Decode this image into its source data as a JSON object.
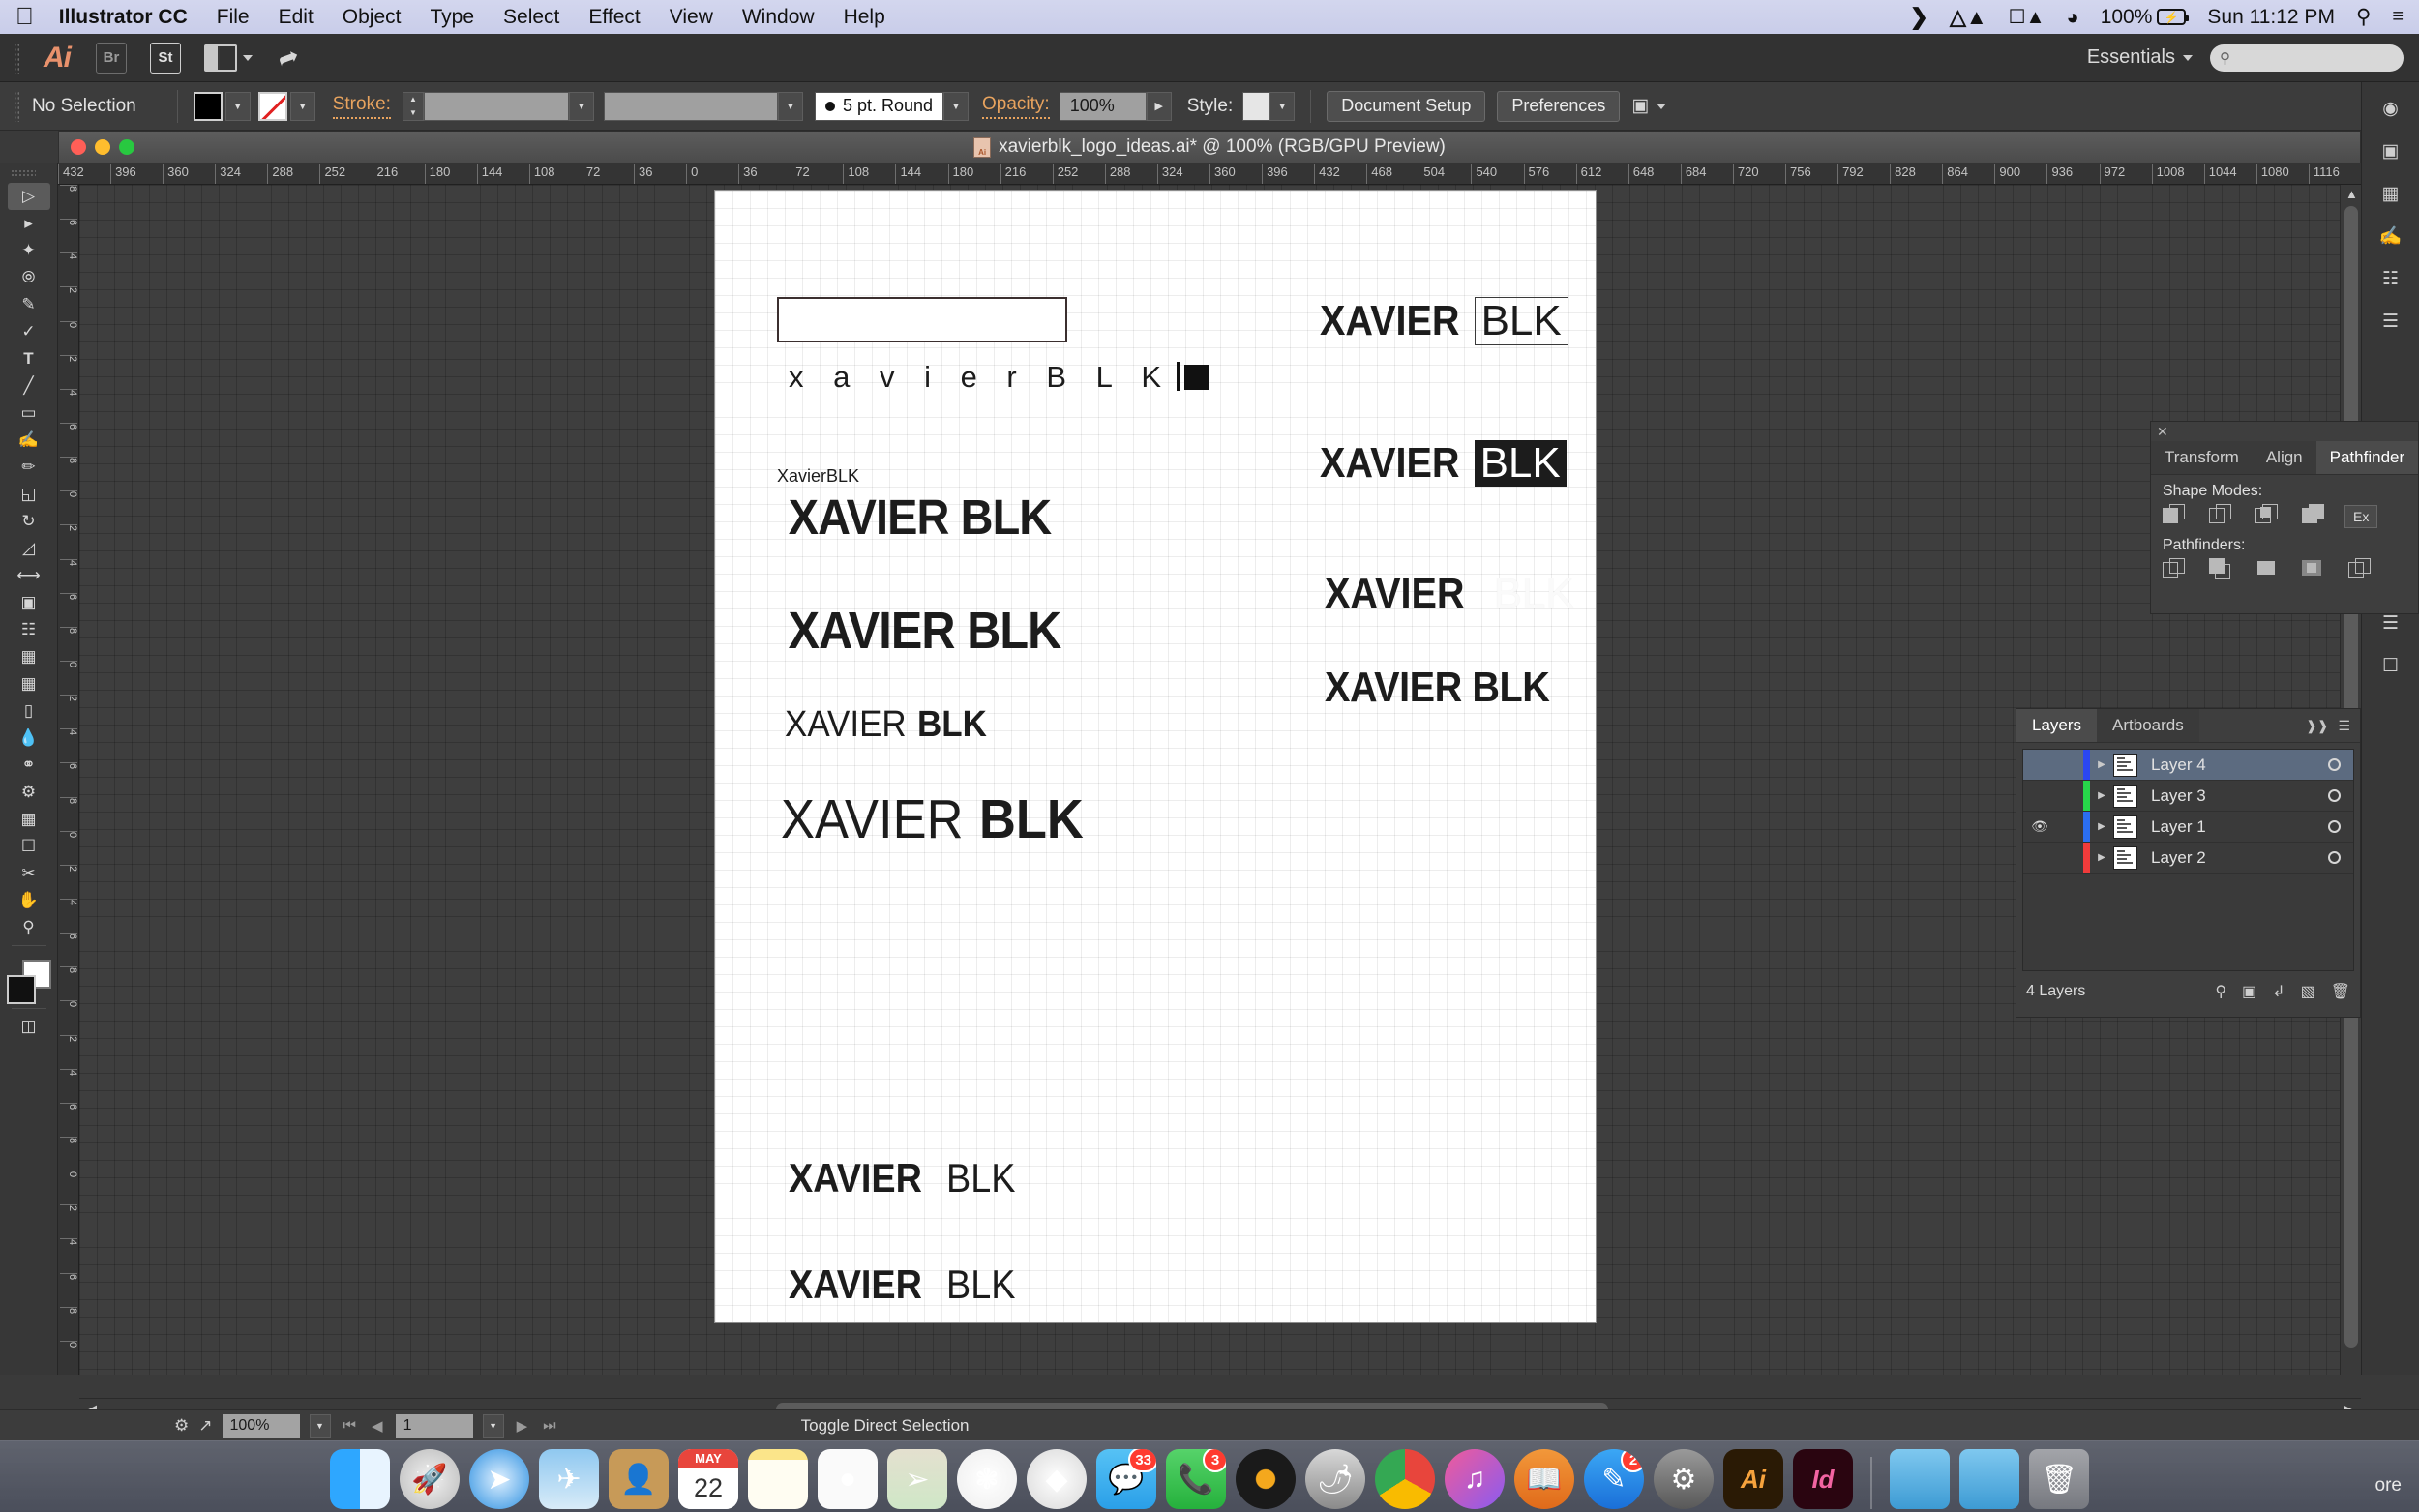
{
  "menubar": {
    "apple": "apple-logo",
    "app_name": "Illustrator CC",
    "items": [
      "File",
      "Edit",
      "Object",
      "Type",
      "Select",
      "Effect",
      "View",
      "Window",
      "Help"
    ],
    "battery_percent": "100%",
    "clock": "Sun 11:12 PM"
  },
  "appbar": {
    "ai_logo": "Ai",
    "bridge_label": "Br",
    "stock_label": "St",
    "workspace": "Essentials",
    "search_placeholder": ""
  },
  "controlbar": {
    "selection_status": "No Selection",
    "stroke_label": "Stroke:",
    "stroke_weight": "",
    "stroke_profile": "",
    "cap_style": "5 pt. Round",
    "opacity_label": "Opacity:",
    "opacity_value": "100%",
    "style_label": "Style:",
    "document_setup": "Document Setup",
    "preferences": "Preferences"
  },
  "document": {
    "title": "xavierblk_logo_ideas.ai* @ 100% (RGB/GPU Preview)"
  },
  "rulers": {
    "horizontal": [
      "432",
      "396",
      "360",
      "324",
      "288",
      "252",
      "216",
      "180",
      "144",
      "108",
      "72",
      "36",
      "0",
      "36",
      "72",
      "108",
      "144",
      "180",
      "216",
      "252",
      "288",
      "324",
      "360",
      "396",
      "432",
      "468",
      "504",
      "540",
      "576",
      "612",
      "648",
      "684",
      "720",
      "756",
      "792",
      "828",
      "864",
      "900",
      "936",
      "972",
      "1008",
      "1044",
      "1080",
      "1116"
    ],
    "vertical": [
      "8",
      "6",
      "4",
      "2",
      "0",
      "2",
      "4",
      "6",
      "8",
      "0",
      "2",
      "4",
      "6",
      "8",
      "0",
      "2",
      "4",
      "6",
      "8",
      "0",
      "2",
      "4",
      "6",
      "8",
      "0",
      "2",
      "4",
      "6",
      "8",
      "0",
      "2",
      "4",
      "6",
      "8",
      "0"
    ]
  },
  "artwork": {
    "variants": [
      {
        "name": "empty-rectangle",
        "text": ""
      },
      {
        "name": "spaced-lowercase-lockup",
        "text": "x a v i e r B L K"
      },
      {
        "name": "small-label",
        "text": "XavierBLK"
      },
      {
        "name": "bold-xavier-blk-1",
        "text": "XAVIER BLK"
      },
      {
        "name": "bold-xavier-blk-2",
        "text": "XAVIER BLK"
      },
      {
        "name": "light-xavier-bold-blk-small",
        "light": "XAVIER",
        "bold": "BLK"
      },
      {
        "name": "light-xavier-bold-blk-large",
        "light": "XAVIER",
        "bold": "BLK"
      },
      {
        "name": "bold-xavier-light-blk-1",
        "bold": "XAVIER",
        "light": "BLK"
      },
      {
        "name": "bold-xavier-light-blk-2",
        "bold": "XAVIER",
        "light": "BLK"
      },
      {
        "name": "xavier-boxed-blk",
        "bold": "XAVIER",
        "boxed": "BLK"
      },
      {
        "name": "xavier-inverted-blk",
        "bold": "XAVIER",
        "inverted": "BLK"
      },
      {
        "name": "xavier-white-blk",
        "bold": "XAVIER",
        "white": "BLK"
      },
      {
        "name": "xavier-blk-plain",
        "text": "XAVIER BLK"
      }
    ]
  },
  "pathfinder": {
    "tabs": [
      "Transform",
      "Align",
      "Pathfinder"
    ],
    "active_tab": "Pathfinder",
    "shape_modes_label": "Shape Modes:",
    "pathfinders_label": "Pathfinders:",
    "expand_label": "Ex"
  },
  "layers": {
    "tabs": [
      "Layers",
      "Artboards"
    ],
    "active_tab": "Layers",
    "rows": [
      {
        "name": "Layer 4",
        "color": "#2b47f0",
        "visible": false,
        "selected": true
      },
      {
        "name": "Layer 3",
        "color": "#27d74a",
        "visible": false,
        "selected": false
      },
      {
        "name": "Layer 1",
        "color": "#2b6ef0",
        "visible": true,
        "selected": false
      },
      {
        "name": "Layer 2",
        "color": "#f03b3b",
        "visible": false,
        "selected": false
      }
    ],
    "count_label": "4 Layers"
  },
  "statusbar": {
    "zoom": "100%",
    "page": "1",
    "status_text": "Toggle Direct Selection"
  },
  "dock": {
    "items": [
      {
        "name": "finder",
        "glyph": "",
        "badge": "",
        "running": true
      },
      {
        "name": "launchpad",
        "glyph": "",
        "badge": "",
        "running": false
      },
      {
        "name": "safari",
        "glyph": "",
        "badge": "",
        "running": false
      },
      {
        "name": "mail",
        "glyph": "",
        "badge": "",
        "running": false
      },
      {
        "name": "contacts",
        "glyph": "",
        "badge": "",
        "running": false
      },
      {
        "name": "calendar",
        "glyph": "",
        "badge": "",
        "running": false,
        "month": "MAY",
        "day": "22"
      },
      {
        "name": "notes",
        "glyph": "",
        "badge": "",
        "running": false
      },
      {
        "name": "reminders",
        "glyph": "",
        "badge": "",
        "running": true
      },
      {
        "name": "maps",
        "glyph": "",
        "badge": "",
        "running": false
      },
      {
        "name": "photos",
        "glyph": "",
        "badge": "",
        "running": false
      },
      {
        "name": "sims",
        "glyph": "",
        "badge": "",
        "running": false
      },
      {
        "name": "messages",
        "glyph": "",
        "badge": "33",
        "running": true
      },
      {
        "name": "facetime",
        "glyph": "",
        "badge": "3",
        "running": false
      },
      {
        "name": "djay",
        "glyph": "",
        "badge": "",
        "running": true
      },
      {
        "name": "fl-studio",
        "glyph": "",
        "badge": "",
        "running": false
      },
      {
        "name": "chrome",
        "glyph": "",
        "badge": "",
        "running": true
      },
      {
        "name": "itunes",
        "glyph": "",
        "badge": "",
        "running": true
      },
      {
        "name": "ibooks",
        "glyph": "",
        "badge": "",
        "running": false
      },
      {
        "name": "app-store",
        "glyph": "",
        "badge": "2",
        "running": false
      },
      {
        "name": "system-preferences",
        "glyph": "",
        "badge": "",
        "running": false
      },
      {
        "name": "illustrator",
        "glyph": "Ai",
        "badge": "",
        "running": true
      },
      {
        "name": "indesign",
        "glyph": "Id",
        "badge": "",
        "running": false
      },
      {
        "name": "documents-folder",
        "glyph": "",
        "badge": "",
        "running": false
      },
      {
        "name": "downloads-folder",
        "glyph": "",
        "badge": "",
        "running": false
      },
      {
        "name": "trash",
        "glyph": "",
        "badge": "",
        "running": false
      }
    ],
    "trailing_text": "ore"
  }
}
